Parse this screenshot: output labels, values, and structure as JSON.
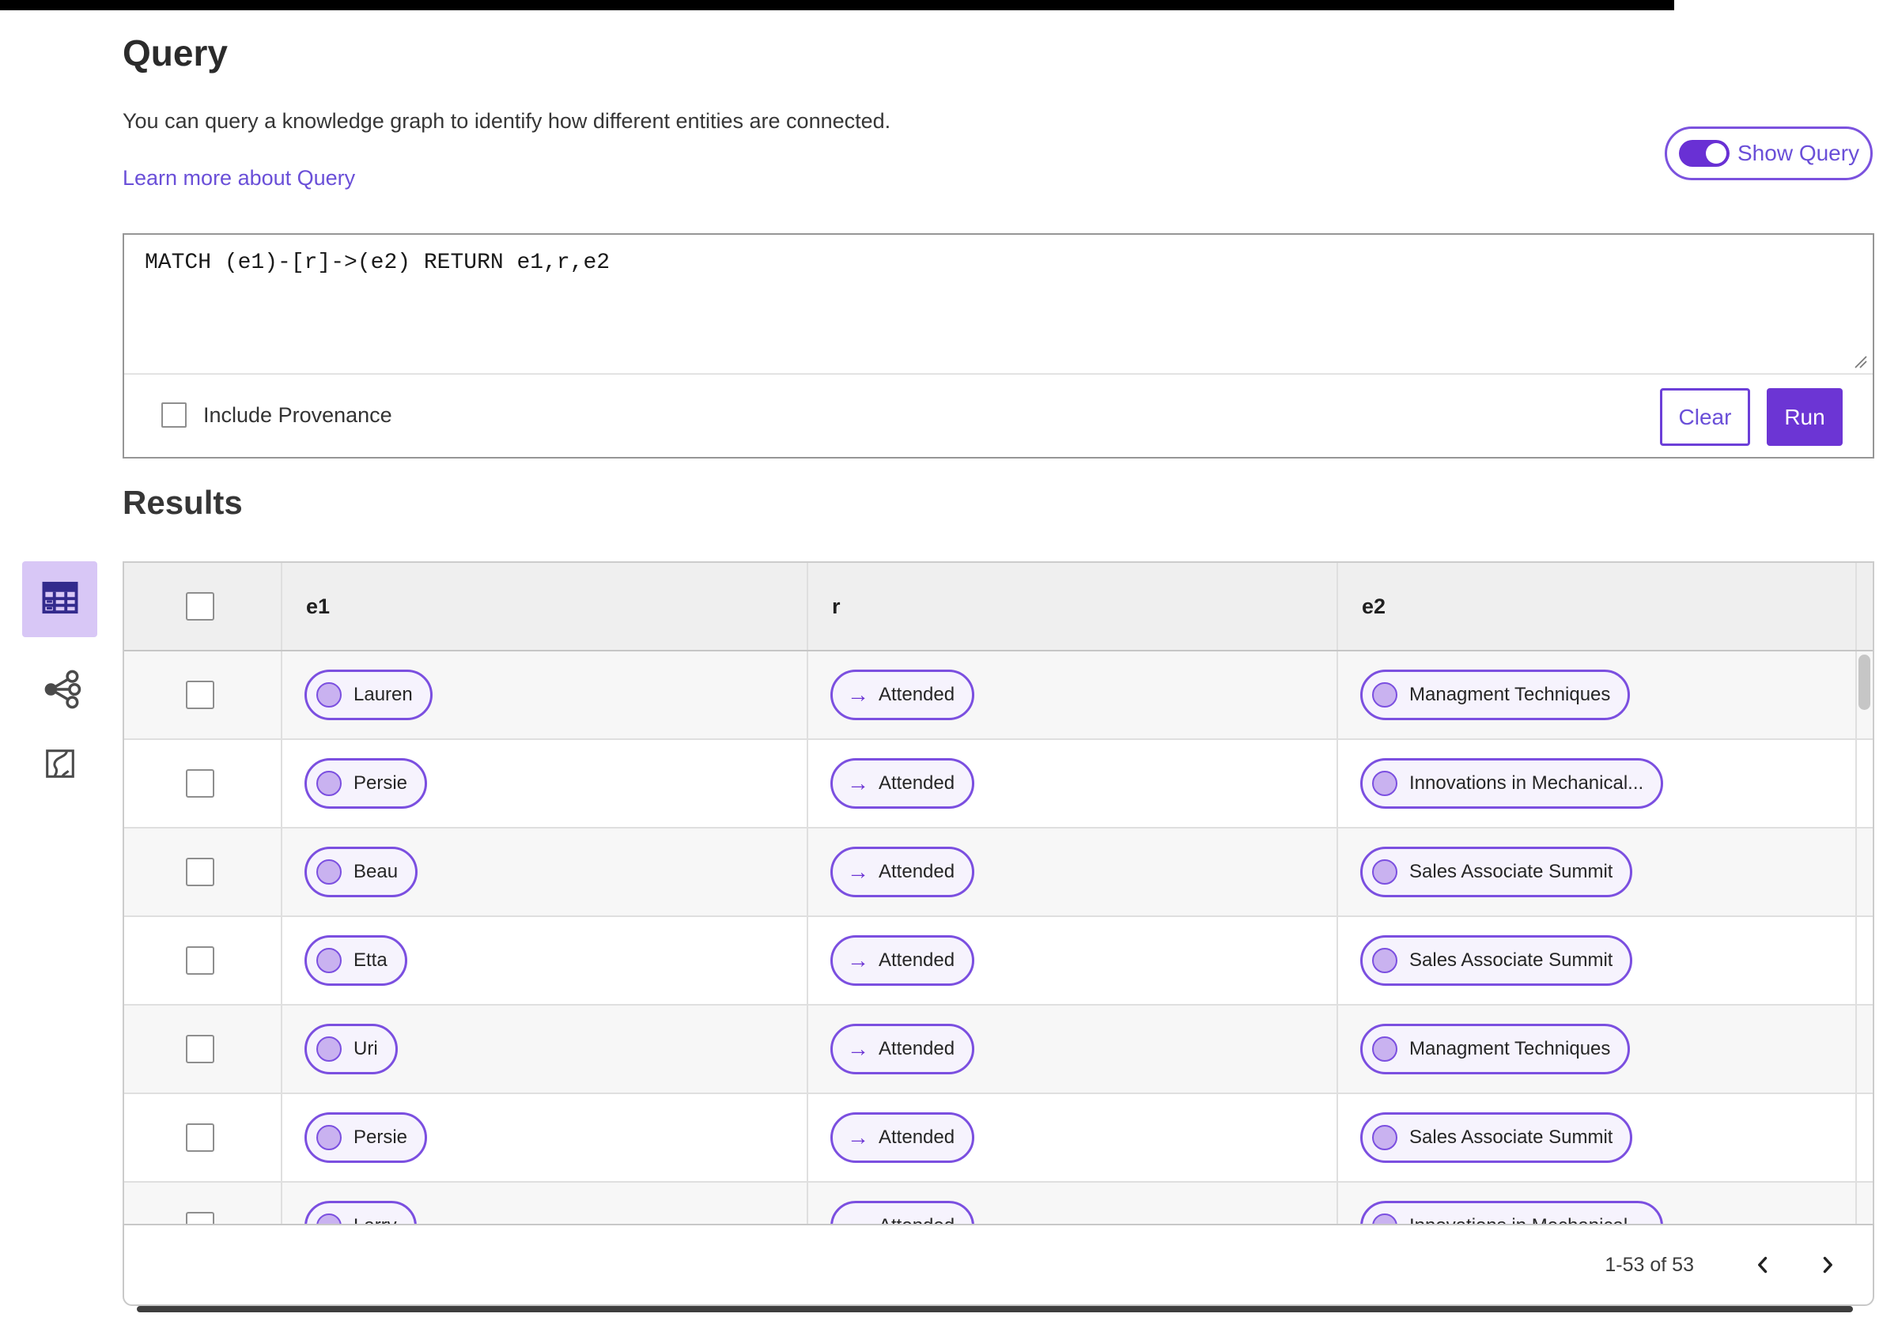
{
  "header": {
    "title": "Query",
    "description": "You can query a knowledge graph to identify how different entities are connected.",
    "learn_more_link": "Learn more about Query",
    "show_query_toggle": {
      "label": "Show Query",
      "state_on": true
    }
  },
  "query_editor": {
    "query_text": "MATCH (e1)-[r]->(e2) RETURN e1,r,e2",
    "include_provenance_label": "Include Provenance",
    "include_provenance_checked": false,
    "clear_button": "Clear",
    "run_button": "Run"
  },
  "results": {
    "title": "Results",
    "view_switcher": [
      {
        "name": "table-view",
        "selected": true
      },
      {
        "name": "graph-view",
        "selected": false
      },
      {
        "name": "map-view",
        "selected": false
      }
    ],
    "table": {
      "select_all_checked": false,
      "columns": [
        "e1",
        "r",
        "e2"
      ],
      "rows": [
        {
          "checked": false,
          "e1": "Lauren",
          "r": "Attended",
          "e2": "Managment Techniques"
        },
        {
          "checked": false,
          "e1": "Persie",
          "r": "Attended",
          "e2": "Innovations in Mechanical..."
        },
        {
          "checked": false,
          "e1": "Beau",
          "r": "Attended",
          "e2": "Sales Associate Summit"
        },
        {
          "checked": false,
          "e1": "Etta",
          "r": "Attended",
          "e2": "Sales Associate Summit"
        },
        {
          "checked": false,
          "e1": "Uri",
          "r": "Attended",
          "e2": "Managment Techniques"
        },
        {
          "checked": false,
          "e1": "Persie",
          "r": "Attended",
          "e2": "Sales Associate Summit"
        },
        {
          "checked": false,
          "e1": "Larry",
          "r": "Attended",
          "e2": "Innovations in Mechanical..."
        }
      ]
    },
    "pagination": {
      "range_label": "1-53 of 53"
    }
  },
  "icons": {
    "relation_arrow": "→"
  },
  "colors": {
    "accent": "#6C35D4",
    "link": "#6A4FD8",
    "pill_border": "#7B4FE0",
    "pill_bg": "#F6F3FD",
    "pill_dot": "#C9B2F0",
    "selected_view_bg": "#D8C7F6",
    "table_header_bg": "#EFEFEF",
    "row_alt_bg": "#F7F7F7"
  }
}
